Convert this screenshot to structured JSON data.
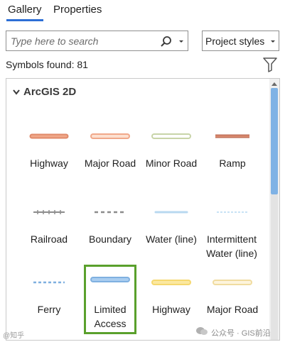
{
  "tabs": [
    {
      "label": "Gallery",
      "active": true
    },
    {
      "label": "Properties",
      "active": false
    }
  ],
  "search": {
    "placeholder": "Type here to search",
    "value": ""
  },
  "styles_dropdown": {
    "selected": "Project styles"
  },
  "symbols_found": "Symbols found: 81",
  "group": {
    "label": "ArcGIS 2D",
    "expanded": true
  },
  "symbols": [
    {
      "label": "Highway",
      "color": "#e08a6a",
      "fill": "#f0a88a",
      "style": "solid-thick"
    },
    {
      "label": "Major Road",
      "color": "#f0a88a",
      "fill": "#fde0d0",
      "style": "outlined"
    },
    {
      "label": "Minor Road",
      "color": "#c8d4a8",
      "fill": "#ffffff",
      "style": "outlined"
    },
    {
      "label": "Ramp",
      "color": "#c0705a",
      "fill": "#d98a6e",
      "style": "solid-thin"
    },
    {
      "label": "Railroad",
      "color": "#8c8c8c",
      "style": "railroad"
    },
    {
      "label": "Boundary",
      "color": "#8c8c8c",
      "style": "dashed"
    },
    {
      "label": "Water (line)",
      "color": "#b8d8f0",
      "style": "thin"
    },
    {
      "label": "Intermittent Water (line)",
      "color": "#c8e2f5",
      "style": "dotted"
    },
    {
      "label": "Ferry",
      "color": "#7fb0e0",
      "style": "dashed-blue"
    },
    {
      "label": "Limited Access",
      "color": "#7fb0e0",
      "fill": "#a9cdf0",
      "style": "outlined",
      "selected": true
    },
    {
      "label": "Highway",
      "color": "#f5d870",
      "fill": "#fbe8a0",
      "style": "outlined"
    },
    {
      "label": "Major Road",
      "color": "#f0dca0",
      "fill": "#fdf4dc",
      "style": "outlined"
    }
  ],
  "watermark": {
    "left": "@知乎",
    "right": "公众号 · GIS前沿"
  }
}
